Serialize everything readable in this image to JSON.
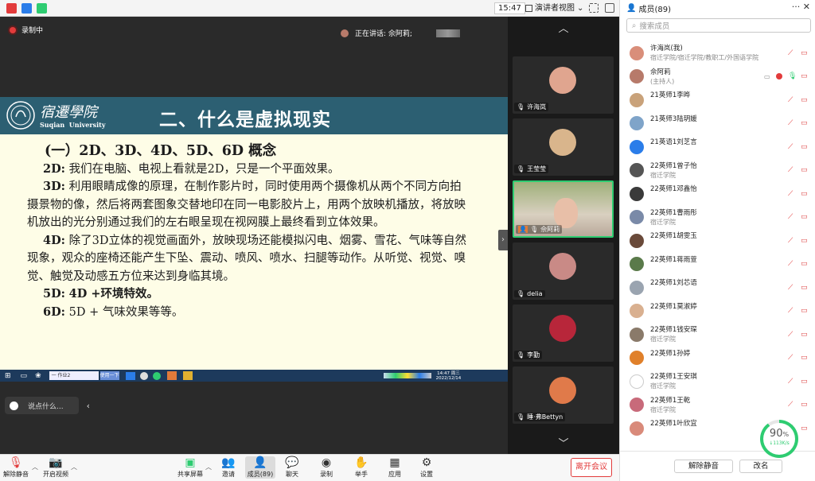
{
  "topbar": {
    "clock": "15:47",
    "view_label": "演讲者视图"
  },
  "stage": {
    "recording_label": "录制中",
    "speaking_label": "正在讲话: 佘阿莉;",
    "slide": {
      "logo_cn": "宿遷學院",
      "logo_en": "Suqian  University",
      "title": "二、什么是虚拟现实",
      "heading": "(一）2D、3D、4D、5D、6D 概念",
      "p1_key": "2D:",
      "p1": "我们在电脑、电视上看就是2D，只是一个平面效果。",
      "p2_key": "3D:",
      "p2": "利用眼睛成像的原理，在制作影片时，同时使用两个摄像机从两个不同方向拍摄景物的像，然后将两套图象交替地印在同一电影胶片上，用两个放映机播放，将放映机放出的光分别通过我们的左右眼呈现在视网膜上最终看到立体效果。",
      "p3_key": "4D:",
      "p3": "除了3D立体的视觉画面外，放映现场还能模拟闪电、烟雾、雪花、气味等自然现象，观众的座椅还能产生下坠、震动、喷风、喷水、扫腿等动作。从听觉、视觉、嗅觉、触觉及动感五方位来达到身临其境。",
      "p4_key": "5D:",
      "p4": "4D +环境特效。",
      "p5_key": "6D:",
      "p5": "5D + 气味效果等等。"
    },
    "taskbar": {
      "search_text": "一 作业2",
      "btn_text": "使用一下",
      "time": "14:47 周三",
      "date": "2022/12/14"
    },
    "say_placeholder": "说点什么..."
  },
  "gallery": {
    "tiles": [
      {
        "name": "许海岚",
        "color": "#e0a58f"
      },
      {
        "name": "王莹莹",
        "color": "#d9b58c"
      },
      {
        "name": "佘阿莉",
        "color": "#8a9a6a"
      },
      {
        "name": "delia",
        "color": "#c98a86"
      },
      {
        "name": "李勤",
        "color": "#b8263a"
      },
      {
        "name": "睡·弗Bettyn",
        "color": "#e07a4a"
      }
    ]
  },
  "panel": {
    "title": "成员(89)",
    "search_placeholder": "搜索成员",
    "members": [
      {
        "name": "许海岚(我)",
        "sub": "宿迁学院/宿迁学院/教职工/外国语学院",
        "color": "#d98e7a"
      },
      {
        "name": "佘阿莉",
        "sub": "(主持人)",
        "color": "#b77a6a"
      },
      {
        "name": "21英师1李晔",
        "sub": "",
        "color": "#c9a27a"
      },
      {
        "name": "21英师3陆玥媛",
        "sub": "",
        "color": "#7fa4c9"
      },
      {
        "name": "21英语1刘芝言",
        "sub": "",
        "color": "#2b7de9"
      },
      {
        "name": "22英师1曾子怡",
        "sub": "宿迁学院",
        "color": "#555"
      },
      {
        "name": "22英师1邓鑫怡",
        "sub": "",
        "color": "#3a3a3a"
      },
      {
        "name": "22英师1曹雨彤",
        "sub": "宿迁学院",
        "color": "#7a8aa8"
      },
      {
        "name": "22英师1胡雯玉",
        "sub": "",
        "color": "#6a4a3a"
      },
      {
        "name": "22英师1蒋雨萱",
        "sub": "",
        "color": "#5a7a4a"
      },
      {
        "name": "22英师1刘芯语",
        "sub": "",
        "color": "#9aa4b0"
      },
      {
        "name": "22英师1莫淑婷",
        "sub": "",
        "color": "#d9b090"
      },
      {
        "name": "22英师1钱安琛",
        "sub": "宿迁学院",
        "color": "#8a7a6a"
      },
      {
        "name": "22英师1孙婷",
        "sub": "",
        "color": "#e0802a"
      },
      {
        "name": "22英师1王安琪",
        "sub": "宿迁学院",
        "color": "#fff"
      },
      {
        "name": "22英师1王乾",
        "sub": "宿迁学院",
        "color": "#c86a7a"
      },
      {
        "name": "22英师1叶欣宜",
        "sub": "",
        "color": "#d98a7a"
      }
    ],
    "unmute_all": "解除静音",
    "rename": "改名"
  },
  "net": {
    "percent": "90",
    "unit": "%",
    "speed": "113K/s"
  },
  "toolbar": {
    "mute": "解除静音",
    "video": "开启视频",
    "share": "共享屏幕",
    "invite": "邀请",
    "members": "成员(89)",
    "chat": "聊天",
    "record": "录制",
    "raise": "举手",
    "apps": "应用",
    "settings": "设置",
    "leave": "离开会议"
  }
}
